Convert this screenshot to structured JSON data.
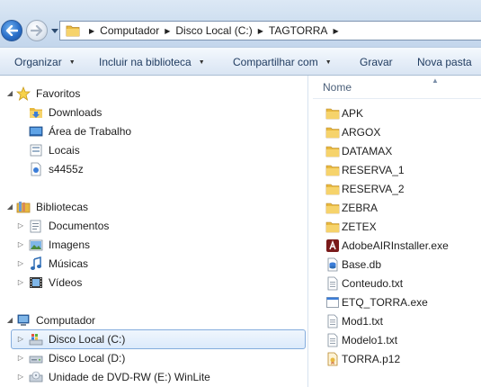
{
  "address": {
    "crumbs": [
      "Computador",
      "Disco Local (C:)",
      "TAGTORRA"
    ],
    "separator": "▶"
  },
  "toolbar": {
    "organize": "Organizar",
    "include_in_library": "Incluir na biblioteca",
    "share_with": "Compartilhar com",
    "burn": "Gravar",
    "new_folder": "Nova pasta"
  },
  "navpane": {
    "favorites": {
      "label": "Favoritos",
      "items": [
        "Downloads",
        "Área de Trabalho",
        "Locais",
        "s4455z"
      ]
    },
    "libraries": {
      "label": "Bibliotecas",
      "items": [
        "Documentos",
        "Imagens",
        "Músicas",
        "Vídeos"
      ]
    },
    "computer": {
      "label": "Computador",
      "items": [
        "Disco Local (C:)",
        "Disco Local (D:)",
        "Unidade de DVD-RW (E:) WinLite"
      ],
      "selected": "Disco Local (C:)"
    }
  },
  "filelist": {
    "column_name": "Nome",
    "files": [
      {
        "name": "APK",
        "icon": "folder-icon"
      },
      {
        "name": "ARGOX",
        "icon": "folder-icon"
      },
      {
        "name": "DATAMAX",
        "icon": "folder-icon"
      },
      {
        "name": "RESERVA_1",
        "icon": "folder-icon"
      },
      {
        "name": "RESERVA_2",
        "icon": "folder-icon"
      },
      {
        "name": "ZEBRA",
        "icon": "folder-icon"
      },
      {
        "name": "ZETEX",
        "icon": "folder-icon"
      },
      {
        "name": "AdobeAIRInstaller.exe",
        "icon": "adobe-air-icon"
      },
      {
        "name": "Base.db",
        "icon": "db-file-icon"
      },
      {
        "name": "Conteudo.txt",
        "icon": "text-file-icon"
      },
      {
        "name": "ETQ_TORRA.exe",
        "icon": "exe-file-icon"
      },
      {
        "name": "Mod1.txt",
        "icon": "text-file-icon"
      },
      {
        "name": "Modelo1.txt",
        "icon": "text-file-icon"
      },
      {
        "name": "TORRA.p12",
        "icon": "certificate-icon"
      }
    ]
  },
  "colors": {
    "accent": "#2a6fc9",
    "folder": "#e8b93f",
    "selection": "#dbeafb"
  }
}
